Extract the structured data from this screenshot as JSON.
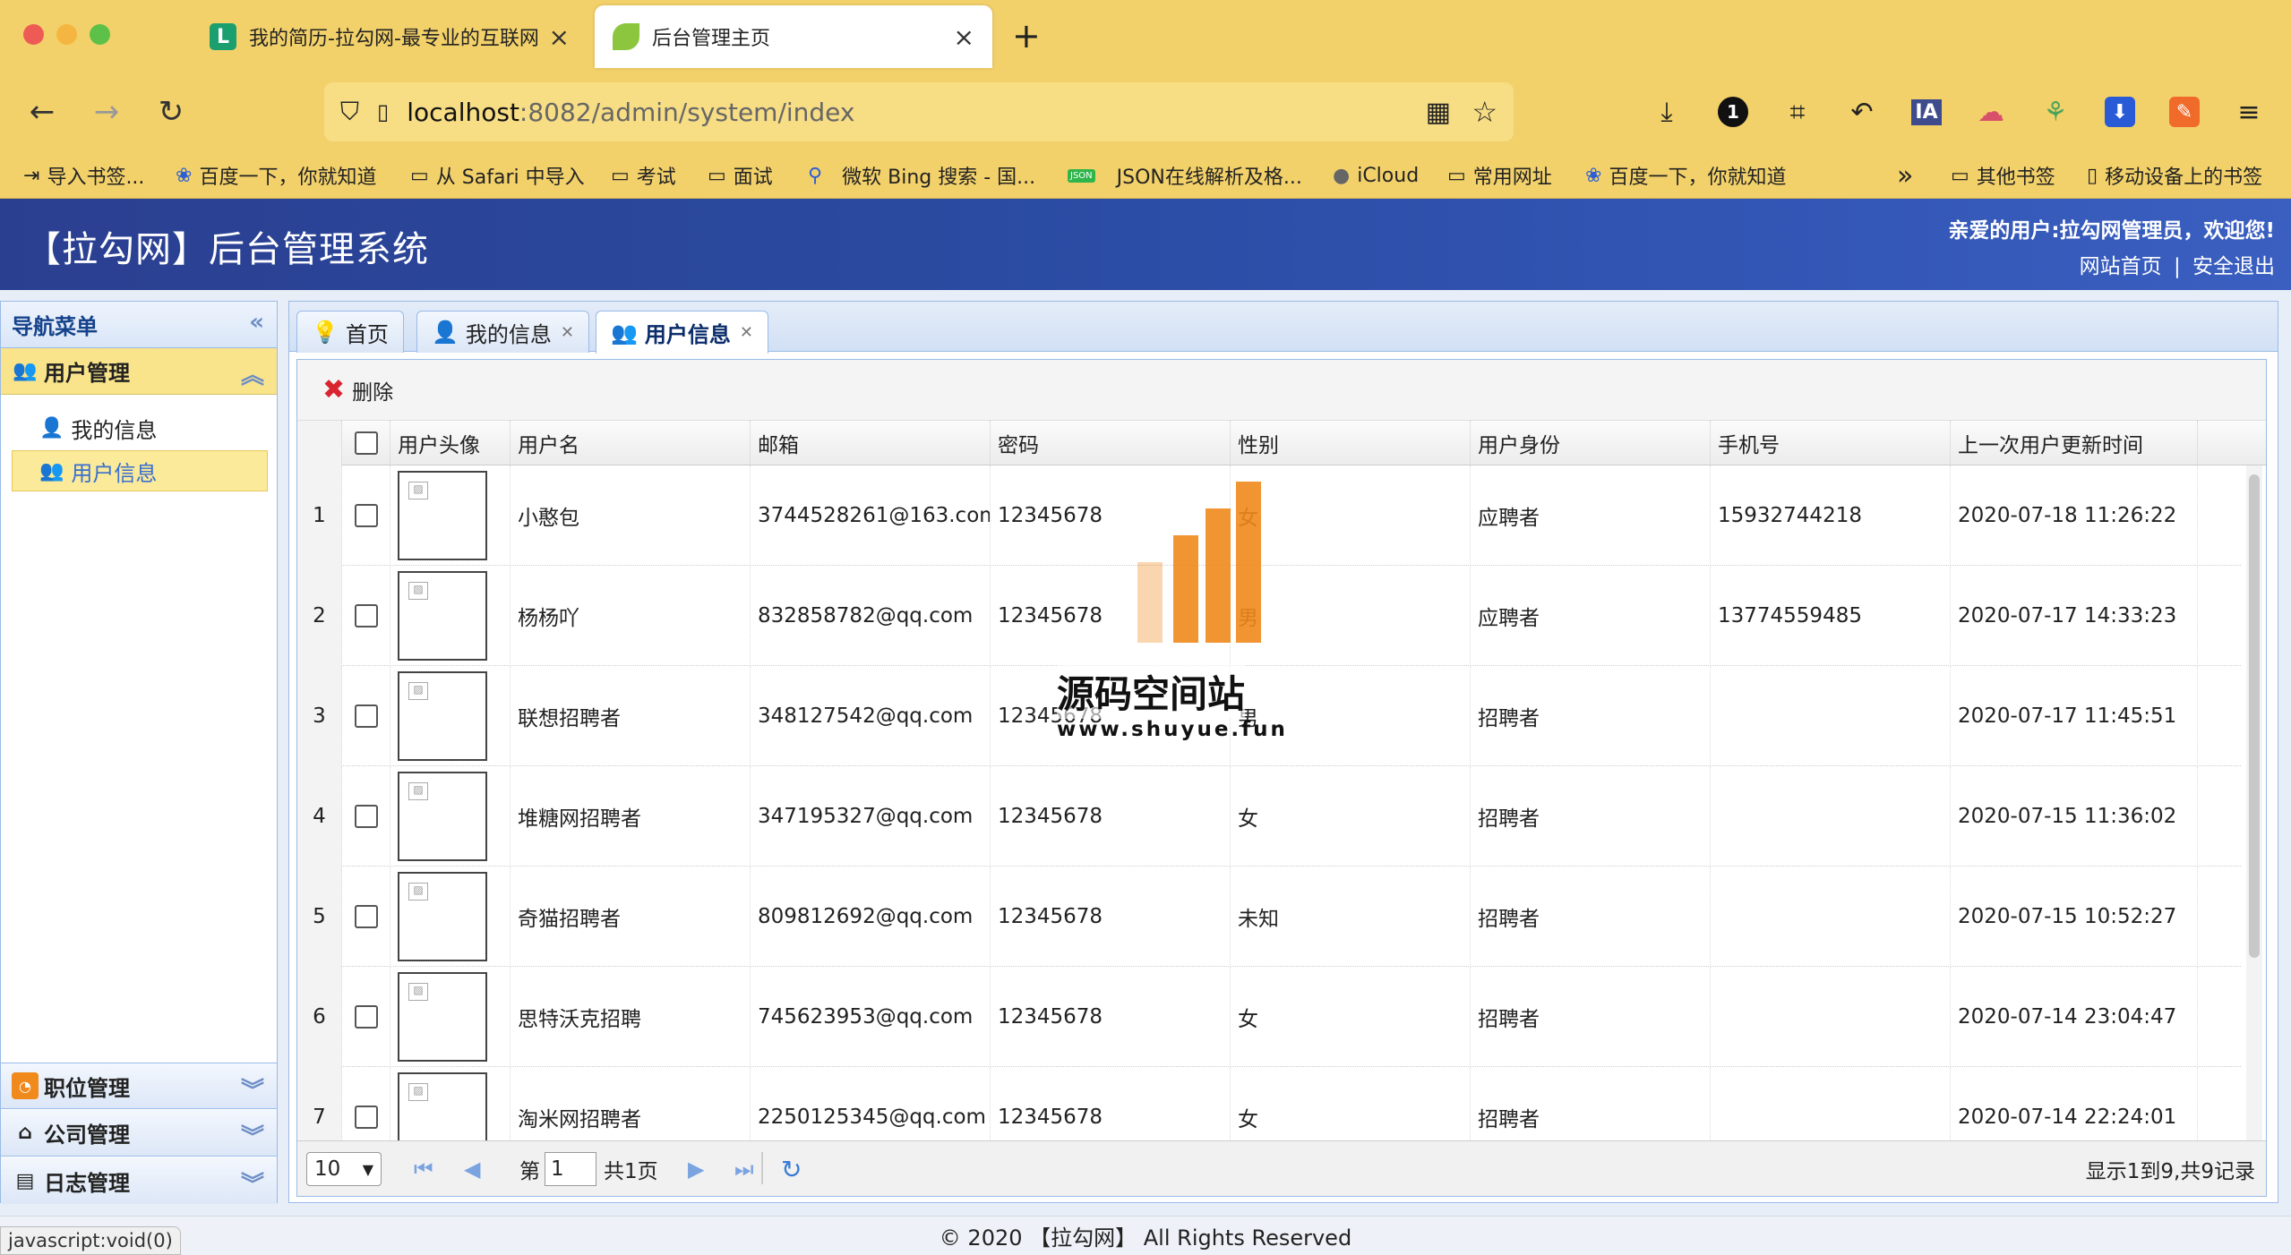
{
  "browser": {
    "tabs": [
      {
        "title": "我的简历-拉勾网-最专业的互联网招聘",
        "icon": "L"
      },
      {
        "title": "后台管理主页",
        "icon": "leaf"
      }
    ],
    "url_host": "localhost",
    "url_rest": ":8082/admin/system/index",
    "bookmarks": [
      "导入书签...",
      "百度一下，你就知道",
      "从 Safari 中导入",
      "考试",
      "面试",
      "微软 Bing 搜索 - 国...",
      "JSON在线解析及格...",
      "iCloud",
      "常用网址",
      "百度一下，你就知道"
    ],
    "bookmarks_right": [
      "其他书签",
      "移动设备上的书签"
    ],
    "badge_number": "1",
    "ext_ia": "IA"
  },
  "header": {
    "title": "【拉勾网】后台管理系统",
    "welcome": "亲爱的用户:拉勾网管理员，欢迎您!",
    "link_home": "网站首页",
    "separator": "|",
    "link_logout": "安全退出"
  },
  "sidebar": {
    "title": "导航菜单",
    "groups": [
      {
        "label": "用户管理",
        "items": [
          "我的信息",
          "用户信息"
        ]
      },
      {
        "label": "职位管理"
      },
      {
        "label": "公司管理"
      },
      {
        "label": "日志管理"
      }
    ]
  },
  "tabs": [
    "首页",
    "我的信息",
    "用户信息"
  ],
  "toolbar": {
    "delete_label": "删除"
  },
  "grid": {
    "columns": [
      "用户头像",
      "用户名",
      "邮箱",
      "密码",
      "性别",
      "用户身份",
      "手机号",
      "上一次用户更新时间"
    ],
    "rows": [
      {
        "n": "1",
        "name": "小憨包",
        "email": "3744528261@163.com",
        "pwd": "12345678",
        "sex": "女",
        "role": "应聘者",
        "phone": "15932744218",
        "time": "2020-07-18 11:26:22"
      },
      {
        "n": "2",
        "name": "杨杨吖",
        "email": "832858782@qq.com",
        "pwd": "12345678",
        "sex": "男",
        "role": "应聘者",
        "phone": "13774559485",
        "time": "2020-07-17 14:33:23"
      },
      {
        "n": "3",
        "name": "联想招聘者",
        "email": "348127542@qq.com",
        "pwd": "12345678",
        "sex": "男",
        "role": "招聘者",
        "phone": "",
        "time": "2020-07-17 11:45:51"
      },
      {
        "n": "4",
        "name": "堆糖网招聘者",
        "email": "347195327@qq.com",
        "pwd": "12345678",
        "sex": "女",
        "role": "招聘者",
        "phone": "",
        "time": "2020-07-15 11:36:02"
      },
      {
        "n": "5",
        "name": "奇猫招聘者",
        "email": "809812692@qq.com",
        "pwd": "12345678",
        "sex": "未知",
        "role": "招聘者",
        "phone": "",
        "time": "2020-07-15 10:52:27"
      },
      {
        "n": "6",
        "name": "思特沃克招聘",
        "email": "745623953@qq.com",
        "pwd": "12345678",
        "sex": "女",
        "role": "招聘者",
        "phone": "",
        "time": "2020-07-14 23:04:47"
      },
      {
        "n": "7",
        "name": "淘米网招聘者",
        "email": "2250125345@qq.com",
        "pwd": "12345678",
        "sex": "女",
        "role": "招聘者",
        "phone": "",
        "time": "2020-07-14 22:24:01"
      }
    ]
  },
  "pager": {
    "page_size": "10",
    "page_prefix": "第",
    "page_value": "1",
    "page_total": "共1页",
    "summary": "显示1到9,共9记录"
  },
  "watermark": {
    "line1": "源码空间站",
    "line2": "www.shuyue.fun"
  },
  "footer": {
    "text": "© 2020 【拉勾网】 All Rights Reserved"
  },
  "statusbar": {
    "text": "javascript:void(0)"
  }
}
